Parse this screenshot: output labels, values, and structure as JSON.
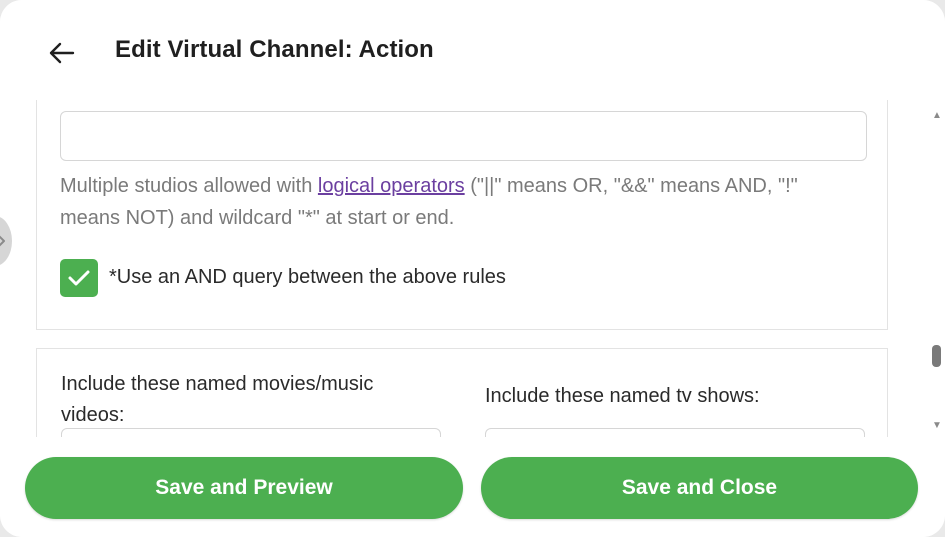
{
  "header": {
    "title": "Edit Virtual Channel: Action",
    "back_icon": "arrow-left-icon"
  },
  "studio_rule": {
    "input_value": "",
    "help_prefix": "Multiple studios allowed with ",
    "help_link": "logical operators",
    "help_suffix": " (\"||\" means OR, \"&&\" means AND, \"!\" means NOT) and wildcard \"*\" at start or end."
  },
  "and_query": {
    "checked": true,
    "label": "*Use an AND query between the above rules"
  },
  "named_items": {
    "movies_label": "Include these named movies/music videos:",
    "movies_value": "",
    "tv_label": "Include these named tv shows:",
    "tv_value": ""
  },
  "footer": {
    "save_preview_label": "Save and Preview",
    "save_close_label": "Save and Close"
  },
  "colors": {
    "accent": "#4caf50",
    "link": "#6b3fa0",
    "help_text": "#7a7a7a"
  }
}
